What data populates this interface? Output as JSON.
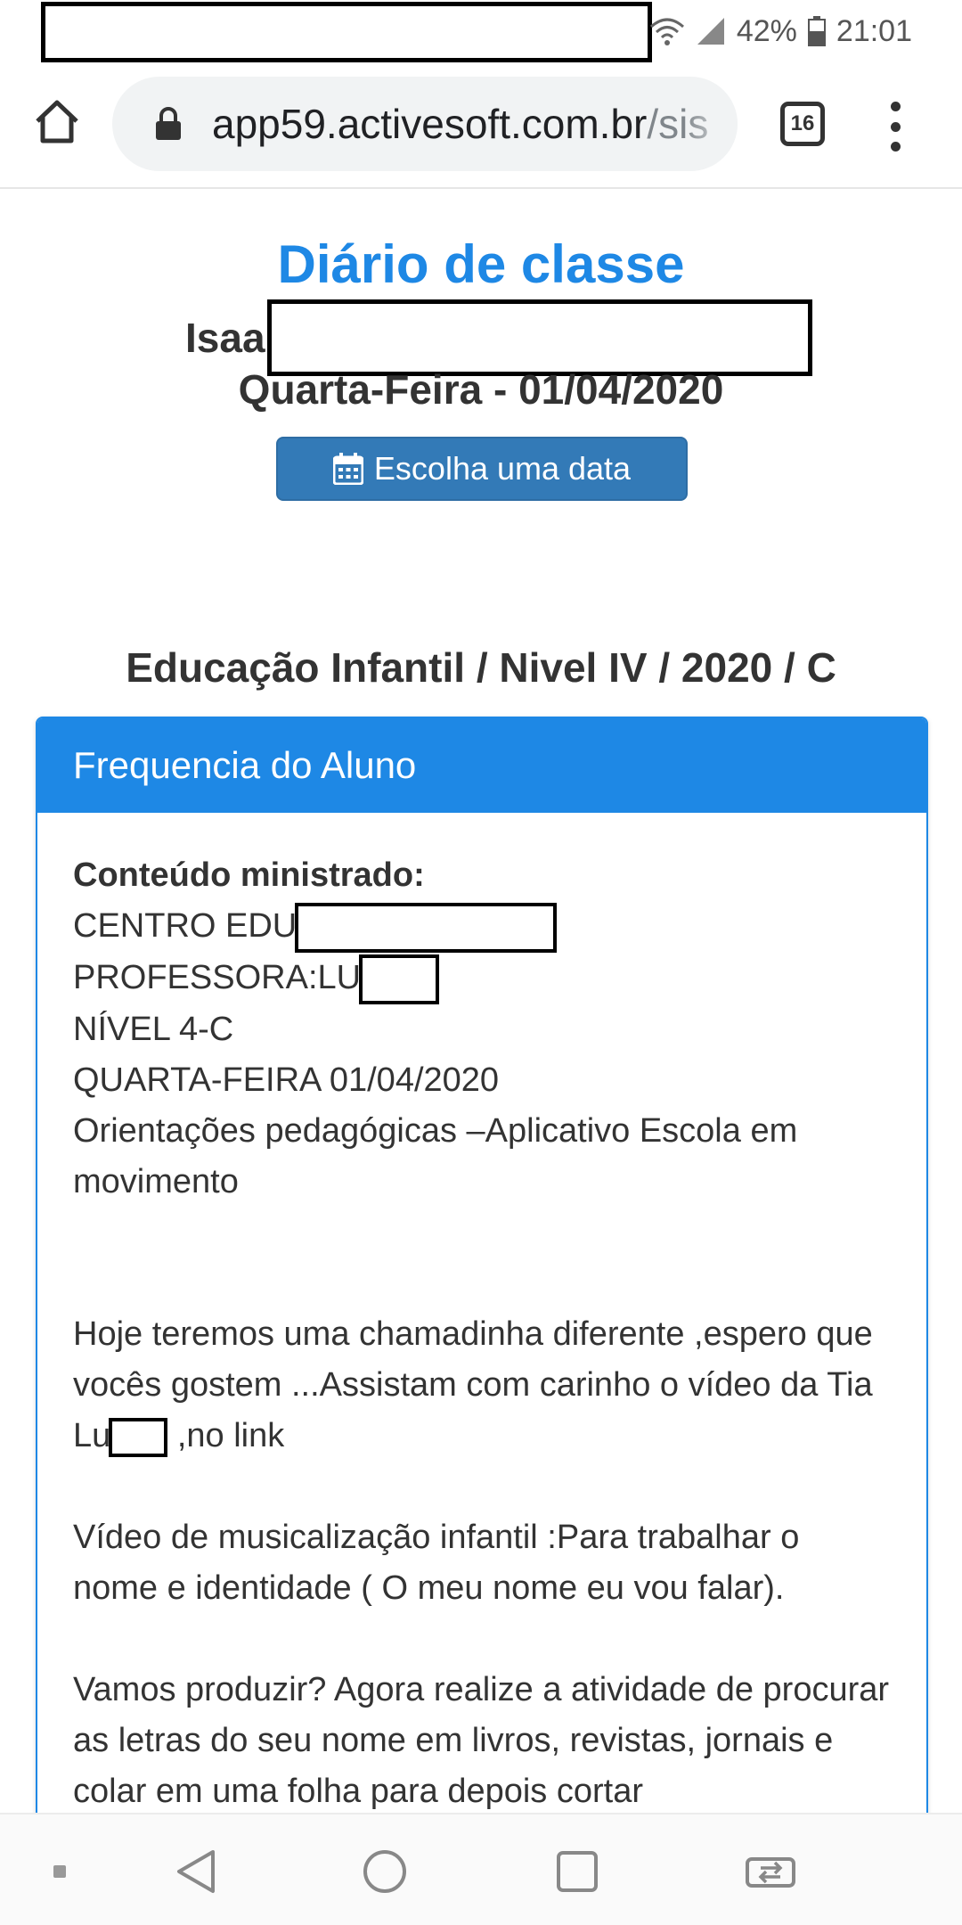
{
  "status_bar": {
    "battery": "42%",
    "time": "21:01"
  },
  "browser": {
    "url_host": "app59.activesoft.com.br",
    "url_rest": "/sis",
    "tab_count": "16"
  },
  "page": {
    "title": "Diário de classe",
    "student_name_visible": "Isaa",
    "day_date": "Quarta-Feira - 01/04/2020",
    "date_button_label": "Escolha uma data",
    "class_path": "Educação Infantil / Nivel IV / 2020 / C"
  },
  "panel": {
    "header": "Frequencia do Aluno",
    "content_label": "Conteúdo ministrado:",
    "lines": {
      "centro": "CENTRO EDU",
      "professora": "PROFESSORA:LU",
      "nivel": "NÍVEL 4-C",
      "data": "QUARTA-FEIRA 01/04/2020",
      "orientacoes": "Orientações pedagógicas –Aplicativo Escola em movimento",
      "chamadinha_1": "Hoje teremos uma chamadinha diferente ,espero que vocês gostem ...Assistam com carinho o vídeo da Tia Lu",
      "chamadinha_2": ",no link",
      "video": "Vídeo de musicalização infantil :Para trabalhar o nome e identidade  ( O meu nome eu vou falar).",
      "produzir": "Vamos produzir? Agora realize a atividade de procurar as letras do seu nome em livros, revistas, jornais e colar em uma folha para depois cortar"
    }
  },
  "colors": {
    "accent": "#1e88e5",
    "button": "#337ab7"
  }
}
